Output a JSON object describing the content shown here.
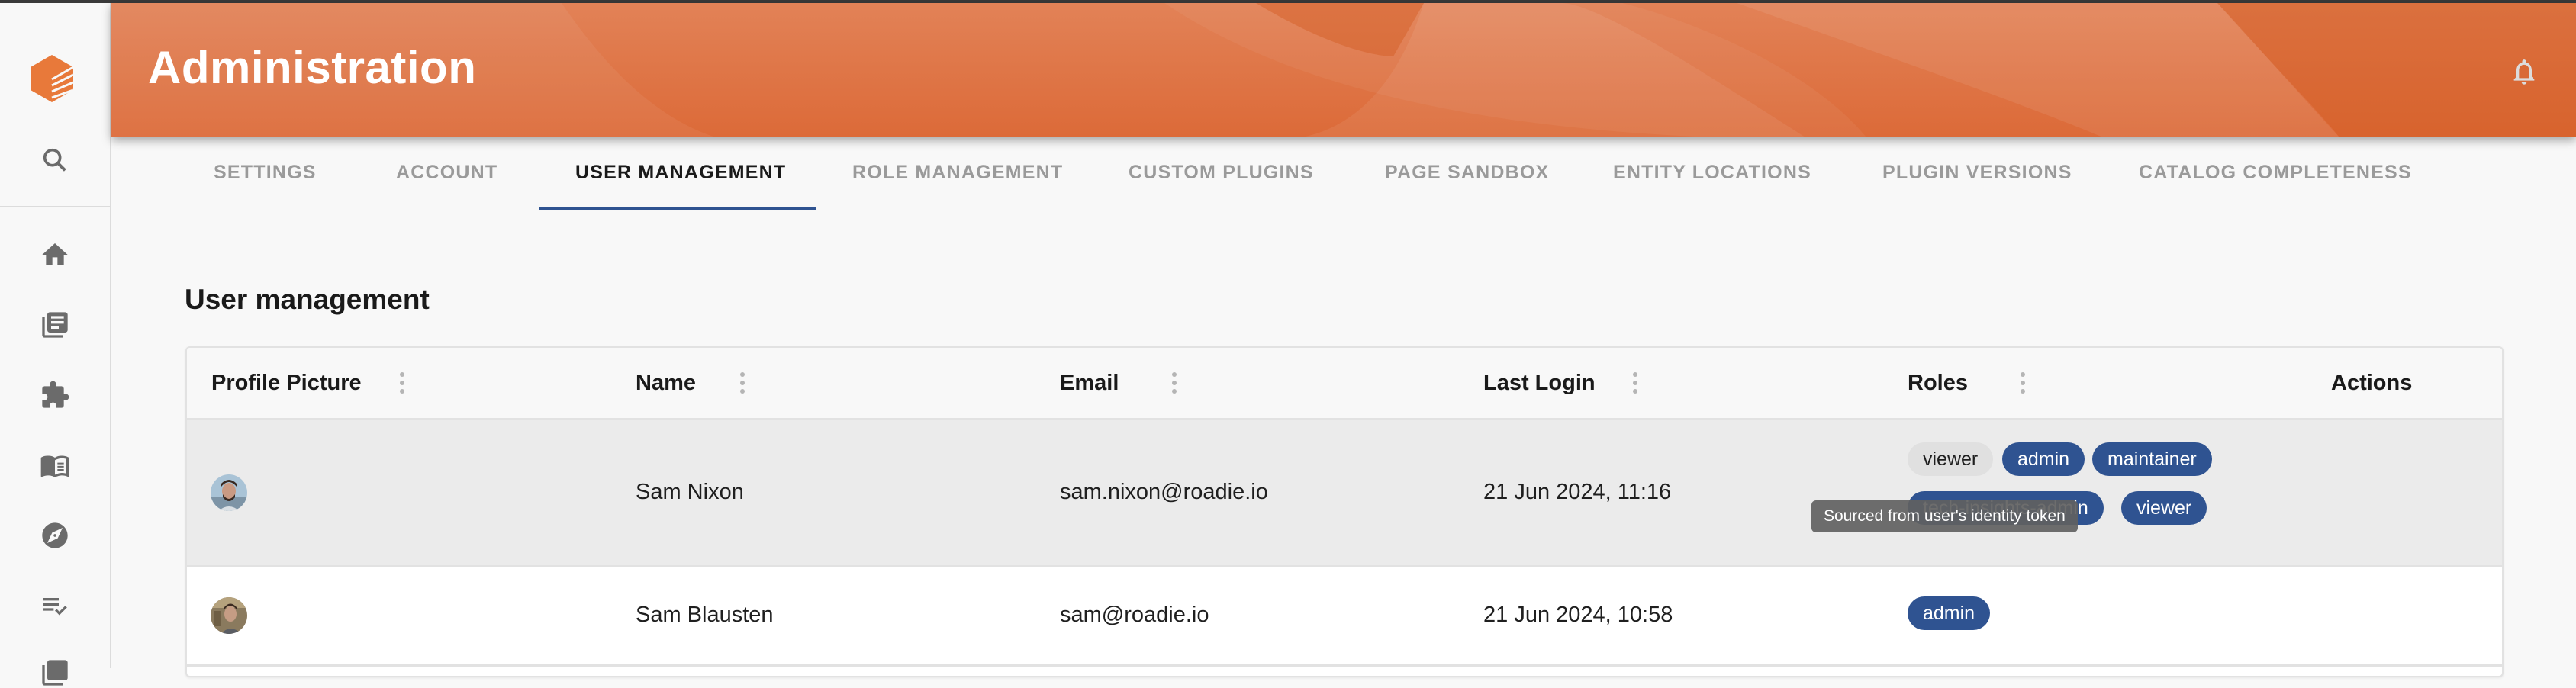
{
  "app": {
    "header_title": "Administration",
    "brand_color": "#de6a35",
    "accent_color": "#2f5391"
  },
  "sidebar": {
    "items": [
      {
        "icon": "logo-icon"
      },
      {
        "icon": "search-icon"
      },
      {
        "icon": "home-icon"
      },
      {
        "icon": "catalog-icon"
      },
      {
        "icon": "puzzle-icon"
      },
      {
        "icon": "docs-book-icon"
      },
      {
        "icon": "compass-icon"
      },
      {
        "icon": "checklist-icon"
      },
      {
        "icon": "list-icon"
      }
    ]
  },
  "tabs": [
    {
      "label": "SETTINGS",
      "active": false
    },
    {
      "label": "ACCOUNT",
      "active": false
    },
    {
      "label": "USER MANAGEMENT",
      "active": true
    },
    {
      "label": "ROLE MANAGEMENT",
      "active": false
    },
    {
      "label": "CUSTOM PLUGINS",
      "active": false
    },
    {
      "label": "PAGE SANDBOX",
      "active": false
    },
    {
      "label": "ENTITY LOCATIONS",
      "active": false
    },
    {
      "label": "PLUGIN VERSIONS",
      "active": false
    },
    {
      "label": "CATALOG COMPLETENESS",
      "active": false
    }
  ],
  "section": {
    "title": "User management"
  },
  "table": {
    "columns": [
      {
        "label": "Profile Picture",
        "has_menu": true
      },
      {
        "label": "Name",
        "has_menu": true
      },
      {
        "label": "Email",
        "has_menu": true
      },
      {
        "label": "Last Login",
        "has_menu": true
      },
      {
        "label": "Roles",
        "has_menu": true
      },
      {
        "label": "Actions",
        "has_menu": false
      }
    ],
    "rows": [
      {
        "name": "Sam Nixon",
        "email": "sam.nixon@roadie.io",
        "last_login": "21 Jun 2024, 11:16",
        "roles": [
          {
            "label": "viewer",
            "source": "identity-token"
          },
          {
            "label": "admin",
            "source": "assigned"
          },
          {
            "label": "maintainer",
            "source": "assigned"
          },
          {
            "label": "tech-insights-admin",
            "source": "assigned"
          },
          {
            "label": "viewer",
            "source": "assigned"
          }
        ],
        "action_icon": "edit-icon",
        "hovered": true
      },
      {
        "name": "Sam Blausten",
        "email": "sam@roadie.io",
        "last_login": "21 Jun 2024, 10:58",
        "roles": [
          {
            "label": "admin",
            "source": "assigned"
          }
        ],
        "action_icon": "edit-icon",
        "hovered": false
      }
    ]
  },
  "tooltip": {
    "text": "Sourced from user's identity token"
  }
}
